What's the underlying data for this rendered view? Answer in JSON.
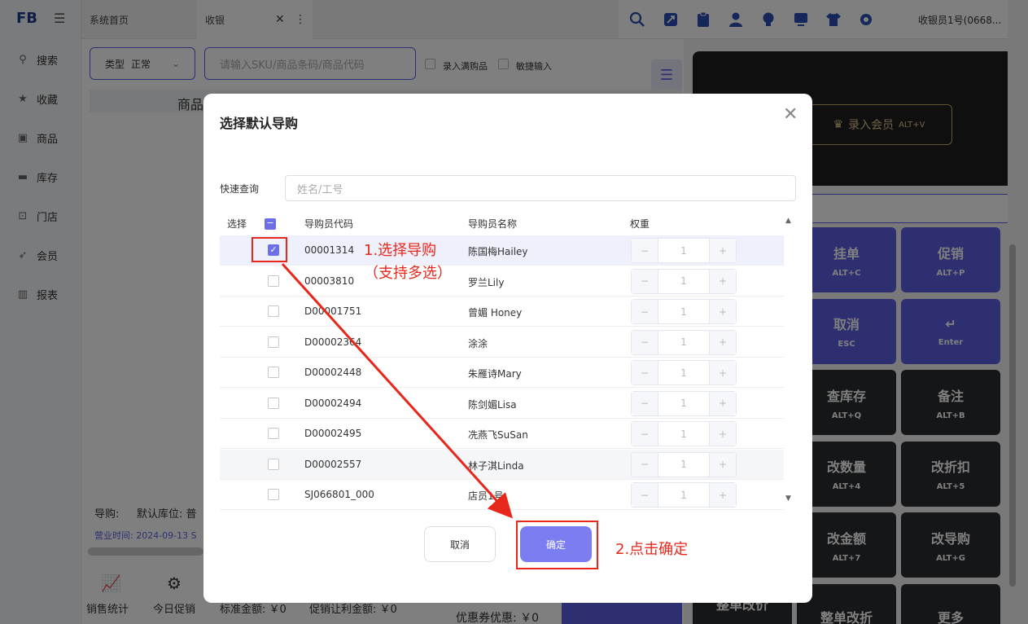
{
  "sidebar": {
    "logo": "FB",
    "items": [
      {
        "label": "搜索",
        "icon": "search-icon"
      },
      {
        "label": "收藏",
        "icon": "star-icon"
      },
      {
        "label": "商品",
        "icon": "product-icon"
      },
      {
        "label": "库存",
        "icon": "inventory-icon"
      },
      {
        "label": "门店",
        "icon": "store-icon"
      },
      {
        "label": "会员",
        "icon": "rocket-icon"
      },
      {
        "label": "报表",
        "icon": "chart-icon"
      }
    ]
  },
  "tabs": [
    {
      "label": "系统首页"
    },
    {
      "label": "收银",
      "active": true
    }
  ],
  "header": {
    "cashier": "收银员1号(0668...",
    "icons": [
      "search-icon",
      "expand-icon",
      "clipboard-icon",
      "user-icon",
      "bulb-icon",
      "monitor-icon",
      "shirt-icon",
      "gear-icon"
    ]
  },
  "toolbar": {
    "type_label": "类型",
    "type_value": "正常",
    "search_placeholder": "请输入SKU/商品条码/商品代码",
    "check_full": "录入满购品",
    "check_quick": "敏捷输入"
  },
  "main": {
    "table_header_partial": "商品",
    "guide_label": "导购:",
    "default_location": "默认库位: 普",
    "business_time": "营业时间: 2024-09-13  S",
    "sales_stats": "销售统计",
    "today_promo": "今日促销",
    "std_amount": "标准金额: ￥0",
    "promo_amount": "促销让利金额: ￥0",
    "coupon": "优惠券优惠: ￥0"
  },
  "right": {
    "member_button": "录入会员",
    "member_shortcut": "ALT+V",
    "keys": [
      {
        "label": "挂单",
        "shortcut": "ALT+C",
        "style": "p"
      },
      {
        "label": "促销",
        "shortcut": "ALT+P",
        "style": "p"
      },
      {
        "label": "取消",
        "shortcut": "ESC",
        "style": "p"
      },
      {
        "label": "↵",
        "shortcut": "Enter",
        "style": "p"
      },
      {
        "label": "查库存",
        "shortcut": "ALT+Q",
        "style": "d"
      },
      {
        "label": "备注",
        "shortcut": "ALT+B",
        "style": "d"
      },
      {
        "label": "改数量",
        "shortcut": "ALT+4",
        "style": "d"
      },
      {
        "label": "改折扣",
        "shortcut": "ALT+5",
        "style": "d"
      },
      {
        "label": "改金额",
        "shortcut": "ALT+7",
        "style": "d"
      },
      {
        "label": "改导购",
        "shortcut": "ALT+G",
        "style": "d"
      },
      {
        "label": "整单改折",
        "shortcut": "",
        "style": "d"
      },
      {
        "label": "更多",
        "shortcut": "",
        "style": "d"
      }
    ],
    "partial_key": "整单改价"
  },
  "modal": {
    "title": "选择默认导购",
    "quick_label": "快速查询",
    "quick_placeholder": "姓名/工号",
    "columns": {
      "select": "选择",
      "code": "导购员代码",
      "name": "导购员名称",
      "weight": "权重"
    },
    "rows": [
      {
        "code": "00001314",
        "name": "陈国梅Hailey",
        "weight": "1",
        "checked": true
      },
      {
        "code": "00003810",
        "name": "罗兰Lily",
        "weight": "1",
        "checked": false
      },
      {
        "code": "D00001751",
        "name": "曾媚 Honey",
        "weight": "1",
        "checked": false
      },
      {
        "code": "D00002364",
        "name": "涂涂",
        "weight": "1",
        "checked": false
      },
      {
        "code": "D00002448",
        "name": "朱雁诗Mary",
        "weight": "1",
        "checked": false
      },
      {
        "code": "D00002494",
        "name": "陈剑媚Lisa",
        "weight": "1",
        "checked": false
      },
      {
        "code": "D00002495",
        "name": "冼燕飞SuSan",
        "weight": "1",
        "checked": false
      },
      {
        "code": "D00002557",
        "name": "林子淇Linda",
        "weight": "1",
        "checked": false
      },
      {
        "code": "SJ066801_000",
        "name": "店员1号",
        "weight": "1",
        "checked": false
      }
    ],
    "cancel": "取消",
    "confirm": "确定"
  },
  "annotations": {
    "step1_line1": "1.选择导购",
    "step1_line2": "（支持多选）",
    "step2": "2.点击确定",
    "color": "#e8271b"
  }
}
